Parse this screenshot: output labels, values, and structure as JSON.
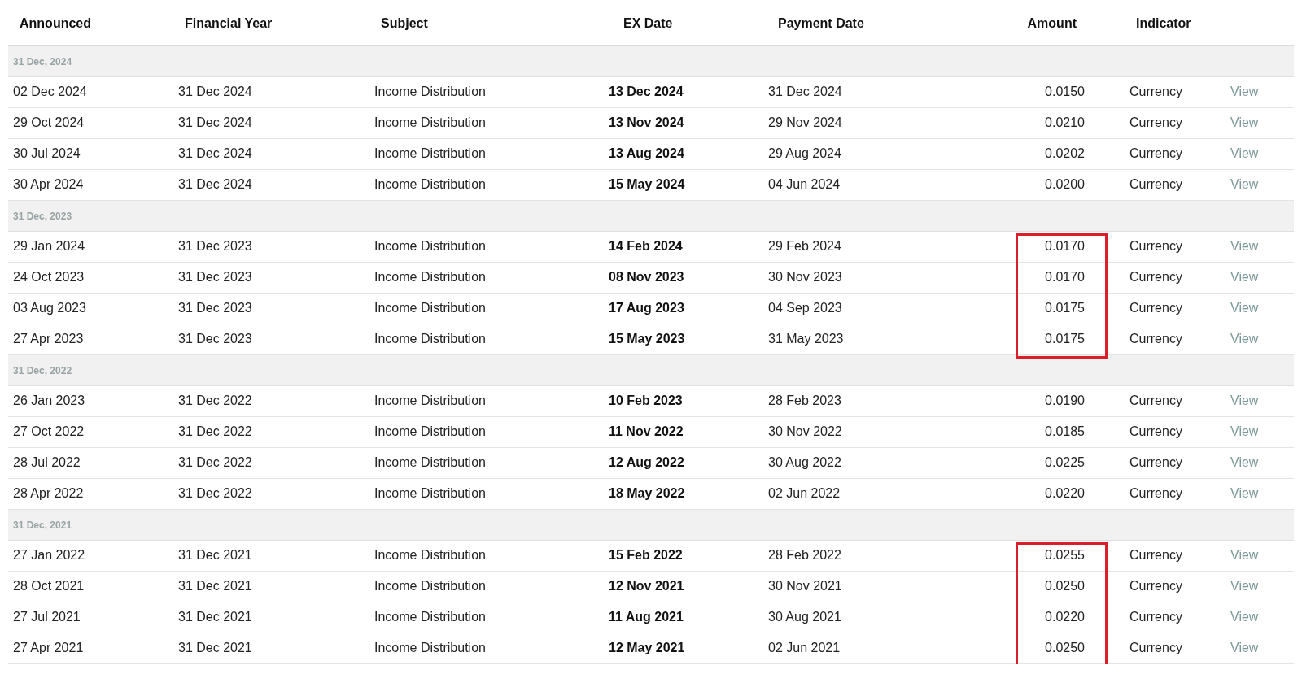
{
  "table": {
    "columns": [
      "Announced",
      "Financial Year",
      "Subject",
      "EX Date",
      "Payment Date",
      "Amount",
      "Indicator"
    ],
    "groups": [
      {
        "label": "31 Dec, 2024",
        "amount_highlighted": false,
        "rows": [
          {
            "announced": "02 Dec 2024",
            "financial_year": "31 Dec 2024",
            "subject": "Income Distribution",
            "ex_date": "13 Dec 2024",
            "payment_date": "31 Dec 2024",
            "amount": "0.0150",
            "indicator": "Currency",
            "link": "View"
          },
          {
            "announced": "29 Oct 2024",
            "financial_year": "31 Dec 2024",
            "subject": "Income Distribution",
            "ex_date": "13 Nov 2024",
            "payment_date": "29 Nov 2024",
            "amount": "0.0210",
            "indicator": "Currency",
            "link": "View"
          },
          {
            "announced": "30 Jul 2024",
            "financial_year": "31 Dec 2024",
            "subject": "Income Distribution",
            "ex_date": "13 Aug 2024",
            "payment_date": "29 Aug 2024",
            "amount": "0.0202",
            "indicator": "Currency",
            "link": "View"
          },
          {
            "announced": "30 Apr 2024",
            "financial_year": "31 Dec 2024",
            "subject": "Income Distribution",
            "ex_date": "15 May 2024",
            "payment_date": "04 Jun 2024",
            "amount": "0.0200",
            "indicator": "Currency",
            "link": "View"
          }
        ]
      },
      {
        "label": "31 Dec, 2023",
        "amount_highlighted": true,
        "rows": [
          {
            "announced": "29 Jan 2024",
            "financial_year": "31 Dec 2023",
            "subject": "Income Distribution",
            "ex_date": "14 Feb 2024",
            "payment_date": "29 Feb 2024",
            "amount": "0.0170",
            "indicator": "Currency",
            "link": "View"
          },
          {
            "announced": "24 Oct 2023",
            "financial_year": "31 Dec 2023",
            "subject": "Income Distribution",
            "ex_date": "08 Nov 2023",
            "payment_date": "30 Nov 2023",
            "amount": "0.0170",
            "indicator": "Currency",
            "link": "View"
          },
          {
            "announced": "03 Aug 2023",
            "financial_year": "31 Dec 2023",
            "subject": "Income Distribution",
            "ex_date": "17 Aug 2023",
            "payment_date": "04 Sep 2023",
            "amount": "0.0175",
            "indicator": "Currency",
            "link": "View"
          },
          {
            "announced": "27 Apr 2023",
            "financial_year": "31 Dec 2023",
            "subject": "Income Distribution",
            "ex_date": "15 May 2023",
            "payment_date": "31 May 2023",
            "amount": "0.0175",
            "indicator": "Currency",
            "link": "View"
          }
        ]
      },
      {
        "label": "31 Dec, 2022",
        "amount_highlighted": false,
        "rows": [
          {
            "announced": "26 Jan 2023",
            "financial_year": "31 Dec 2022",
            "subject": "Income Distribution",
            "ex_date": "10 Feb 2023",
            "payment_date": "28 Feb 2023",
            "amount": "0.0190",
            "indicator": "Currency",
            "link": "View"
          },
          {
            "announced": "27 Oct 2022",
            "financial_year": "31 Dec 2022",
            "subject": "Income Distribution",
            "ex_date": "11 Nov 2022",
            "payment_date": "30 Nov 2022",
            "amount": "0.0185",
            "indicator": "Currency",
            "link": "View"
          },
          {
            "announced": "28 Jul 2022",
            "financial_year": "31 Dec 2022",
            "subject": "Income Distribution",
            "ex_date": "12 Aug 2022",
            "payment_date": "30 Aug 2022",
            "amount": "0.0225",
            "indicator": "Currency",
            "link": "View"
          },
          {
            "announced": "28 Apr 2022",
            "financial_year": "31 Dec 2022",
            "subject": "Income Distribution",
            "ex_date": "18 May 2022",
            "payment_date": "02 Jun 2022",
            "amount": "0.0220",
            "indicator": "Currency",
            "link": "View"
          }
        ]
      },
      {
        "label": "31 Dec, 2021",
        "amount_highlighted": true,
        "rows": [
          {
            "announced": "27 Jan 2022",
            "financial_year": "31 Dec 2021",
            "subject": "Income Distribution",
            "ex_date": "15 Feb 2022",
            "payment_date": "28 Feb 2022",
            "amount": "0.0255",
            "indicator": "Currency",
            "link": "View"
          },
          {
            "announced": "28 Oct 2021",
            "financial_year": "31 Dec 2021",
            "subject": "Income Distribution",
            "ex_date": "12 Nov 2021",
            "payment_date": "30 Nov 2021",
            "amount": "0.0250",
            "indicator": "Currency",
            "link": "View"
          },
          {
            "announced": "27 Jul 2021",
            "financial_year": "31 Dec 2021",
            "subject": "Income Distribution",
            "ex_date": "11 Aug 2021",
            "payment_date": "30 Aug 2021",
            "amount": "0.0220",
            "indicator": "Currency",
            "link": "View"
          },
          {
            "announced": "27 Apr 2021",
            "financial_year": "31 Dec 2021",
            "subject": "Income Distribution",
            "ex_date": "12 May 2021",
            "payment_date": "02 Jun 2021",
            "amount": "0.0250",
            "indicator": "Currency",
            "link": "View"
          }
        ]
      }
    ]
  }
}
